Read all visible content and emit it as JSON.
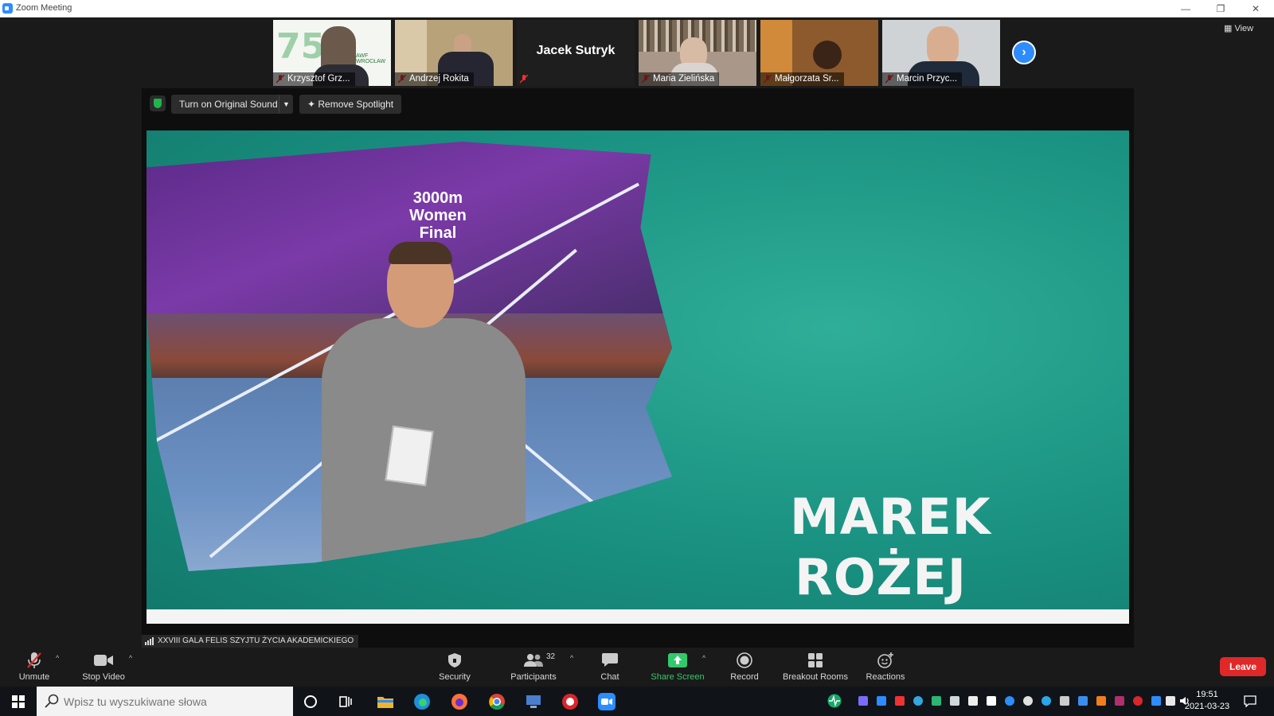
{
  "window": {
    "title": "Zoom Meeting",
    "controls": [
      "—",
      "❐",
      "✕"
    ]
  },
  "thumbnails": [
    {
      "name": "Krzysztof Grz...",
      "muted": true,
      "bg": "#f4f6f2",
      "logo": "75",
      "logo_sub": "AWF WROCŁAW"
    },
    {
      "name": "Andrzej Rokita",
      "muted": true,
      "bg": "#b8a27a"
    },
    {
      "name": "",
      "big_name": "Jacek Sutryk",
      "muted": true,
      "bg": "#1e1e1e"
    },
    {
      "name": "Maria Zielińska",
      "muted": true,
      "bg": "#a9978a"
    },
    {
      "name": "Małgorzata Sr...",
      "muted": true,
      "bg": "#8c5a2c"
    },
    {
      "name": "Marcin Przyc...",
      "muted": true,
      "bg": "#cfd3d6"
    }
  ],
  "view_button": "View",
  "stage": {
    "original_sound_button": "Turn on Original Sound",
    "remove_spotlight_button": "Remove Spotlight",
    "screen_text": [
      "3000m",
      "Women",
      "Final"
    ],
    "speaker_name_line1": "MAREK",
    "speaker_name_line2": "ROŻEJ",
    "caption": "XXVIII GALA FELIS SZYJTU ŻYCIA AKADEMICKIEGO"
  },
  "toolbar": {
    "unmute": "Unmute",
    "stop_video": "Stop Video",
    "security": "Security",
    "participants": "Participants",
    "participants_count": "32",
    "chat": "Chat",
    "share_screen": "Share Screen",
    "record": "Record",
    "breakout_rooms": "Breakout Rooms",
    "reactions": "Reactions",
    "leave": "Leave"
  },
  "taskbar": {
    "search_placeholder": "Wpisz tu wyszukiwane słowa",
    "time": "19:51",
    "date": "2021-03-23"
  },
  "colors": {
    "zoom_blue": "#2d8cff",
    "leave_red": "#e02828",
    "share_green": "#32c96a",
    "slide_teal": "#1a9a86"
  }
}
